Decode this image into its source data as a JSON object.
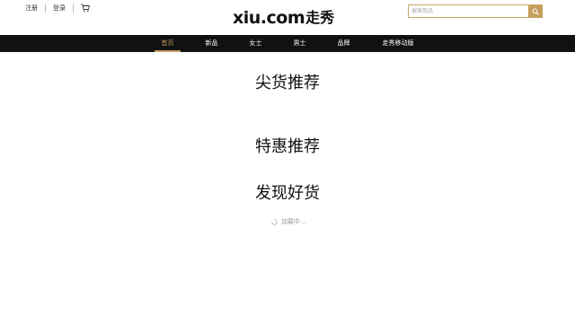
{
  "header": {
    "links": {
      "register": "注册",
      "login": "登录"
    },
    "logo": {
      "latin": "xiu.com",
      "cjk": "走秀"
    },
    "search": {
      "placeholder": "搜索商品"
    }
  },
  "nav": {
    "items": [
      {
        "label": "首页",
        "active": true
      },
      {
        "label": "新品"
      },
      {
        "label": "女士"
      },
      {
        "label": "男士"
      },
      {
        "label": "品牌"
      },
      {
        "label": "走秀移动版"
      }
    ]
  },
  "sections": {
    "s1": "尖货推荐",
    "s2": "特惠推荐",
    "s3": "发现好货"
  },
  "loading": {
    "text": "加载中..."
  },
  "colors": {
    "accent": "#c59e5b",
    "nav_bg": "#111111"
  }
}
